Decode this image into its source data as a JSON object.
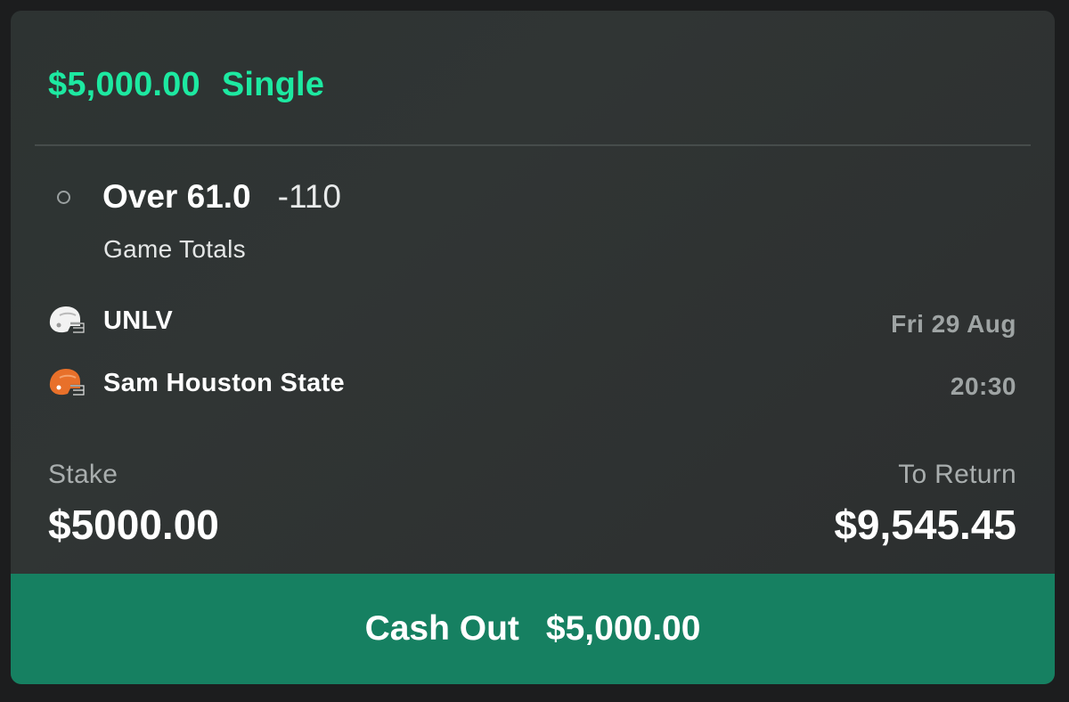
{
  "bet": {
    "stake_amount": "$5,000.00",
    "bet_type": "Single"
  },
  "selection": {
    "name": "Over 61.0",
    "odds": "-110",
    "market": "Game Totals"
  },
  "event": {
    "home_team": "UNLV",
    "away_team": "Sam Houston State",
    "date": "Fri 29 Aug",
    "time": "20:30"
  },
  "summary": {
    "stake_label": "Stake",
    "stake_value": "$5000.00",
    "return_label": "To Return",
    "return_value": "$9,545.45"
  },
  "cashout": {
    "label": "Cash Out",
    "amount": "$5,000.00"
  },
  "icons": {
    "selection_status": "radio-circle-icon",
    "home_team": "football-helmet-icon",
    "away_team": "football-helmet-icon"
  },
  "colors": {
    "accent": "#1de9a1",
    "cashout_bg": "#168061",
    "card_bg": "#2f3433",
    "away_helmet": "#e8702a",
    "home_helmet": "#f2f2f2"
  }
}
